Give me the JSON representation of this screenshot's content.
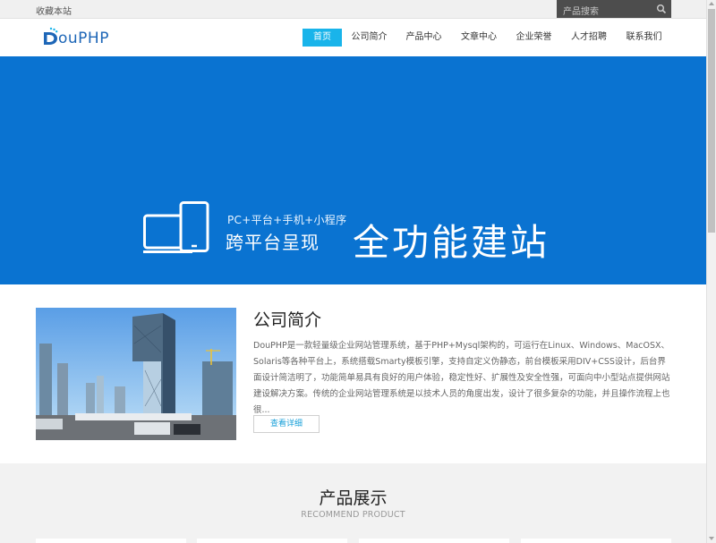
{
  "topbar": {
    "favorite_label": "收藏本站",
    "search_placeholder": "产品搜索"
  },
  "logo": {
    "text": "ouPHP"
  },
  "nav": {
    "items": [
      {
        "label": "首页"
      },
      {
        "label": "公司简介"
      },
      {
        "label": "产品中心"
      },
      {
        "label": "文章中心"
      },
      {
        "label": "企业荣誉"
      },
      {
        "label": "人才招聘"
      },
      {
        "label": "联系我们"
      }
    ],
    "active_index": 0
  },
  "banner": {
    "small_text": "PC+平台+手机+小程序",
    "mid_text": "跨平台呈现",
    "big_text": "全功能建站",
    "background_color": "#0a73d1",
    "slide_count": 4,
    "current_slide": 1
  },
  "about": {
    "title": "公司简介",
    "description": "DouPHP是一款轻量级企业网站管理系统，基于PHP+Mysql架构的，可运行在Linux、Windows、MacOSX、Solaris等各种平台上，系统搭载Smarty模板引擎，支持自定义伪静态，前台模板采用DIV+CSS设计，后台界面设计简洁明了，功能简单易具有良好的用户体验，稳定性好、扩展性及安全性强，可面向中小型站点提供网站建设解决方案。传统的企业网站管理系统是以技术人员的角度出发，设计了很多复杂的功能，并且操作流程上也很...",
    "more_label": "查看详细"
  },
  "products": {
    "title": "产品展示",
    "subtitle": "RECOMMEND PRODUCT"
  },
  "colors": {
    "accent": "#19b4ea",
    "brand_blue": "#1d66b7",
    "search_bg": "#4d4d4d"
  }
}
